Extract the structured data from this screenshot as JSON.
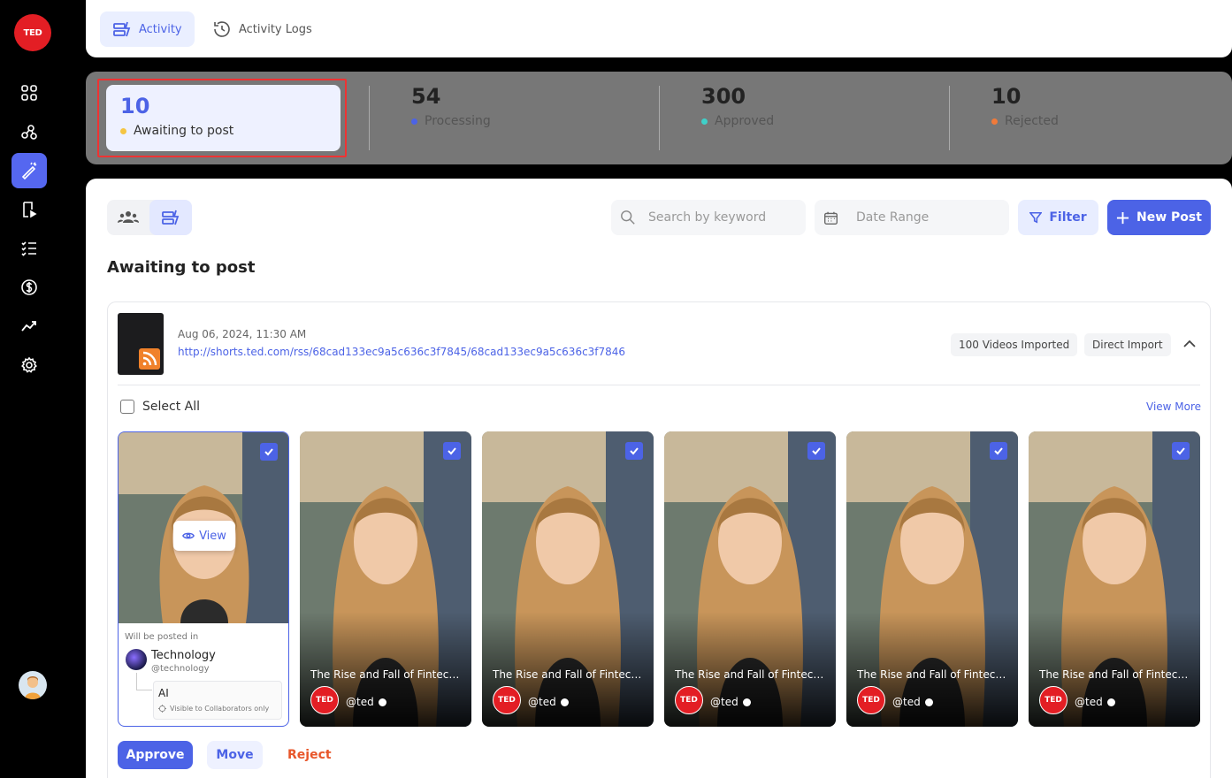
{
  "brand": {
    "logo_text": "TED",
    "accent": "#4c63e6",
    "brand_red": "#e31e24"
  },
  "sidebar": {
    "items": [
      {
        "icon": "grid-icon"
      },
      {
        "icon": "network-icon"
      },
      {
        "icon": "magic-pen-icon",
        "active": true
      },
      {
        "icon": "video-import-icon"
      },
      {
        "icon": "checklist-icon"
      },
      {
        "icon": "dollar-icon"
      },
      {
        "icon": "analytics-icon"
      },
      {
        "icon": "settings-icon"
      }
    ]
  },
  "header": {
    "tabs": [
      {
        "label": "Activity",
        "icon": "activity-icon",
        "active": true
      },
      {
        "label": "Activity Logs",
        "icon": "history-icon",
        "active": false
      }
    ]
  },
  "stats": [
    {
      "value": "10",
      "label": "Awaiting to post",
      "color": "#f5c542"
    },
    {
      "value": "54",
      "label": "Processing",
      "color": "#4c63e6"
    },
    {
      "value": "300",
      "label": "Approved",
      "color": "#3fd0c9"
    },
    {
      "value": "10",
      "label": "Rejected",
      "color": "#f07a3a"
    }
  ],
  "toolbar": {
    "search_placeholder": "Search by keyword",
    "date_placeholder": "Date Range",
    "filter_label": "Filter",
    "new_post_label": "New Post"
  },
  "section_title": "Awaiting to post",
  "import": {
    "date": "Aug 06, 2024, 11:30 AM",
    "url": "http://shorts.ted.com/rss/68cad133ec9a5c636c3f7845/68cad133ec9a5c636c3f7846",
    "videos_imported": "100 Videos Imported",
    "source": "Direct Import",
    "select_all": "Select All",
    "view_more": "View More"
  },
  "first_tile": {
    "view_label": "View",
    "posted_in_label": "Will be posted in",
    "channel_name": "Technology",
    "channel_handle": "@technology",
    "sub_channel": "AI",
    "sub_note": "Visible to Collaborators only"
  },
  "videos": [
    {
      "title": "The Rise and Fall of Fintech...",
      "avatar": "TED",
      "handle": "@ted"
    },
    {
      "title": "The Rise and Fall of Fintech...",
      "avatar": "TED",
      "handle": "@ted"
    },
    {
      "title": "The Rise and Fall of Fintech...",
      "avatar": "TED",
      "handle": "@ted"
    },
    {
      "title": "The Rise and Fall of Fintech...",
      "avatar": "TED",
      "handle": "@ted"
    },
    {
      "title": "The Rise and Fall of Fintech...",
      "avatar": "TED",
      "handle": "@ted"
    }
  ],
  "actions": {
    "approve": "Approve",
    "move": "Move",
    "reject": "Reject"
  }
}
